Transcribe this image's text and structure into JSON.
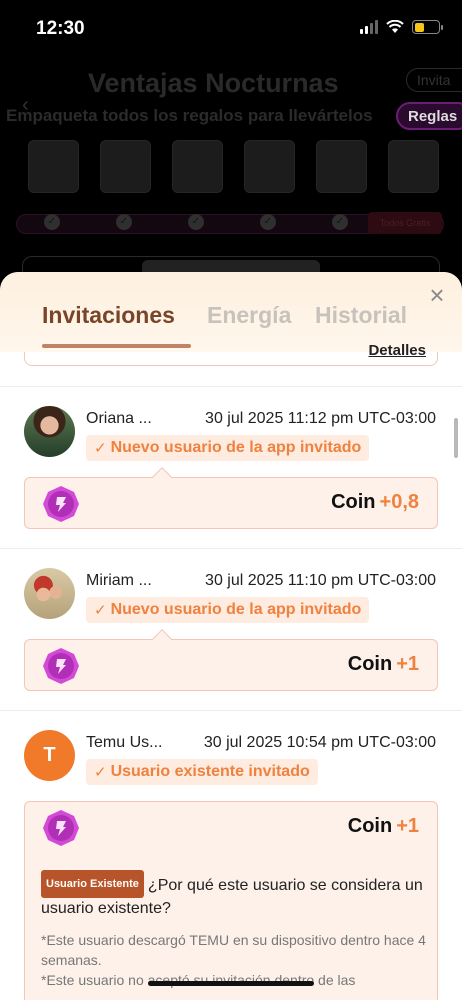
{
  "status_bar": {
    "time": "12:30",
    "battery_fraction": 0.4
  },
  "background": {
    "title": "Ventajas Nocturnas",
    "subtitle": "Empaqueta todos los regalos para llevártelos",
    "invite_label": "Invita",
    "rules_label": "Reglas",
    "last_badge": "Todos Gratis"
  },
  "sheet": {
    "tabs": [
      {
        "label": "Invitaciones",
        "active": true
      },
      {
        "label": "Energía",
        "active": false
      },
      {
        "label": "Historial",
        "active": false
      }
    ],
    "details_link": "Detalles",
    "entries": [
      {
        "name": "Oriana ...",
        "date": "30 jul 2025 11:12 pm UTC-03:00",
        "tag": "Nuevo usuario de la app invitado",
        "reward_label": "Coin",
        "reward_amount": "+0,8"
      },
      {
        "name": "Miriam ...",
        "date": "30 jul 2025 11:10 pm UTC-03:00",
        "tag": "Nuevo usuario de la app invitado",
        "reward_label": "Coin",
        "reward_amount": "+1"
      },
      {
        "name": "Temu Us...",
        "avatar_letter": "T",
        "date": "30 jul 2025 10:54 pm UTC-03:00",
        "tag": "Usuario existente invitado",
        "reward_label": "Coin",
        "reward_amount": "+1",
        "badge": "Usuario Existente",
        "question": "¿Por qué este usuario se considera un usuario existente?",
        "note_1": "*Este usuario descargó TEMU en su dispositivo dentro hace 4 semanas.",
        "note_2": "*Este usuario no aceptó su invitación dentro de las"
      }
    ]
  },
  "colors": {
    "accent": "#f0813e",
    "tab_active": "#7a4428",
    "coin": "#c537c8"
  }
}
